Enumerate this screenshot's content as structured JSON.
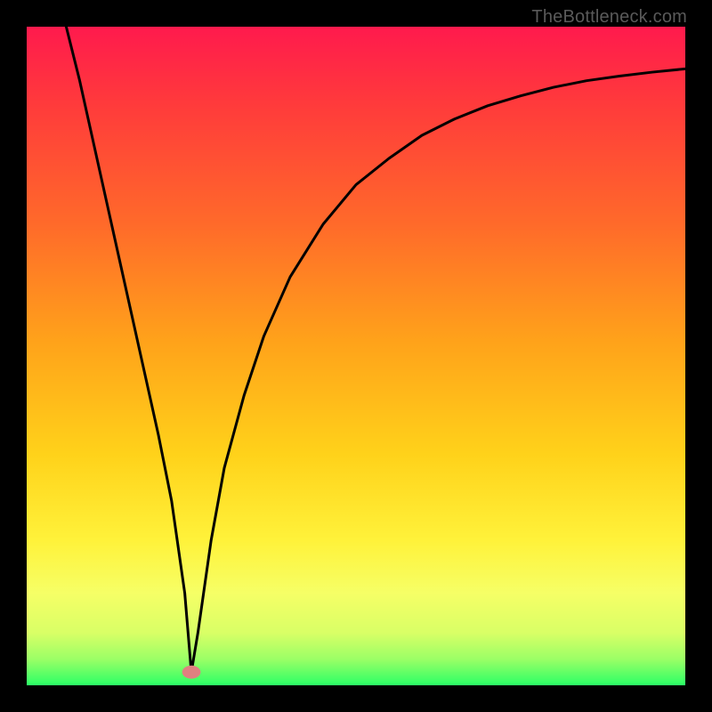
{
  "watermark": "TheBottleneck.com",
  "chart_data": {
    "type": "line",
    "title": "",
    "xlabel": "",
    "ylabel": "",
    "xlim": [
      0,
      100
    ],
    "ylim": [
      0,
      100
    ],
    "grid": false,
    "legend": false,
    "notes": "Background is a vertical gradient from red at the top through orange and yellow to green at the bottom. Main curve is a black V-shaped line with minimum near x≈25, y≈0, left side nearly straight and steep, right side rising and flattening toward the top-right. A small pink dot marks the minimum.",
    "gradient_stops": [
      {
        "offset": 0.0,
        "color": "#ff1a4d"
      },
      {
        "offset": 0.12,
        "color": "#ff3b3b"
      },
      {
        "offset": 0.3,
        "color": "#ff6a2a"
      },
      {
        "offset": 0.48,
        "color": "#ffa31a"
      },
      {
        "offset": 0.65,
        "color": "#ffd21a"
      },
      {
        "offset": 0.78,
        "color": "#fff23a"
      },
      {
        "offset": 0.86,
        "color": "#f6ff66"
      },
      {
        "offset": 0.92,
        "color": "#d9ff66"
      },
      {
        "offset": 0.96,
        "color": "#9cff66"
      },
      {
        "offset": 1.0,
        "color": "#2bff66"
      }
    ],
    "series": [
      {
        "name": "bottleneck-curve",
        "x": [
          6,
          8,
          10,
          12,
          14,
          16,
          18,
          20,
          22,
          24,
          25,
          26,
          28,
          30,
          33,
          36,
          40,
          45,
          50,
          55,
          60,
          65,
          70,
          75,
          80,
          85,
          90,
          95,
          100
        ],
        "y": [
          100,
          92,
          83,
          74,
          65,
          56,
          47,
          38,
          28,
          14,
          2,
          8,
          22,
          33,
          44,
          53,
          62,
          70,
          76,
          80,
          83.5,
          86,
          88,
          89.5,
          90.8,
          91.8,
          92.5,
          93.1,
          93.6
        ]
      }
    ],
    "marker": {
      "x": 25,
      "y": 2,
      "rx": 1.4,
      "ry": 1.0,
      "color": "#e08080"
    }
  }
}
